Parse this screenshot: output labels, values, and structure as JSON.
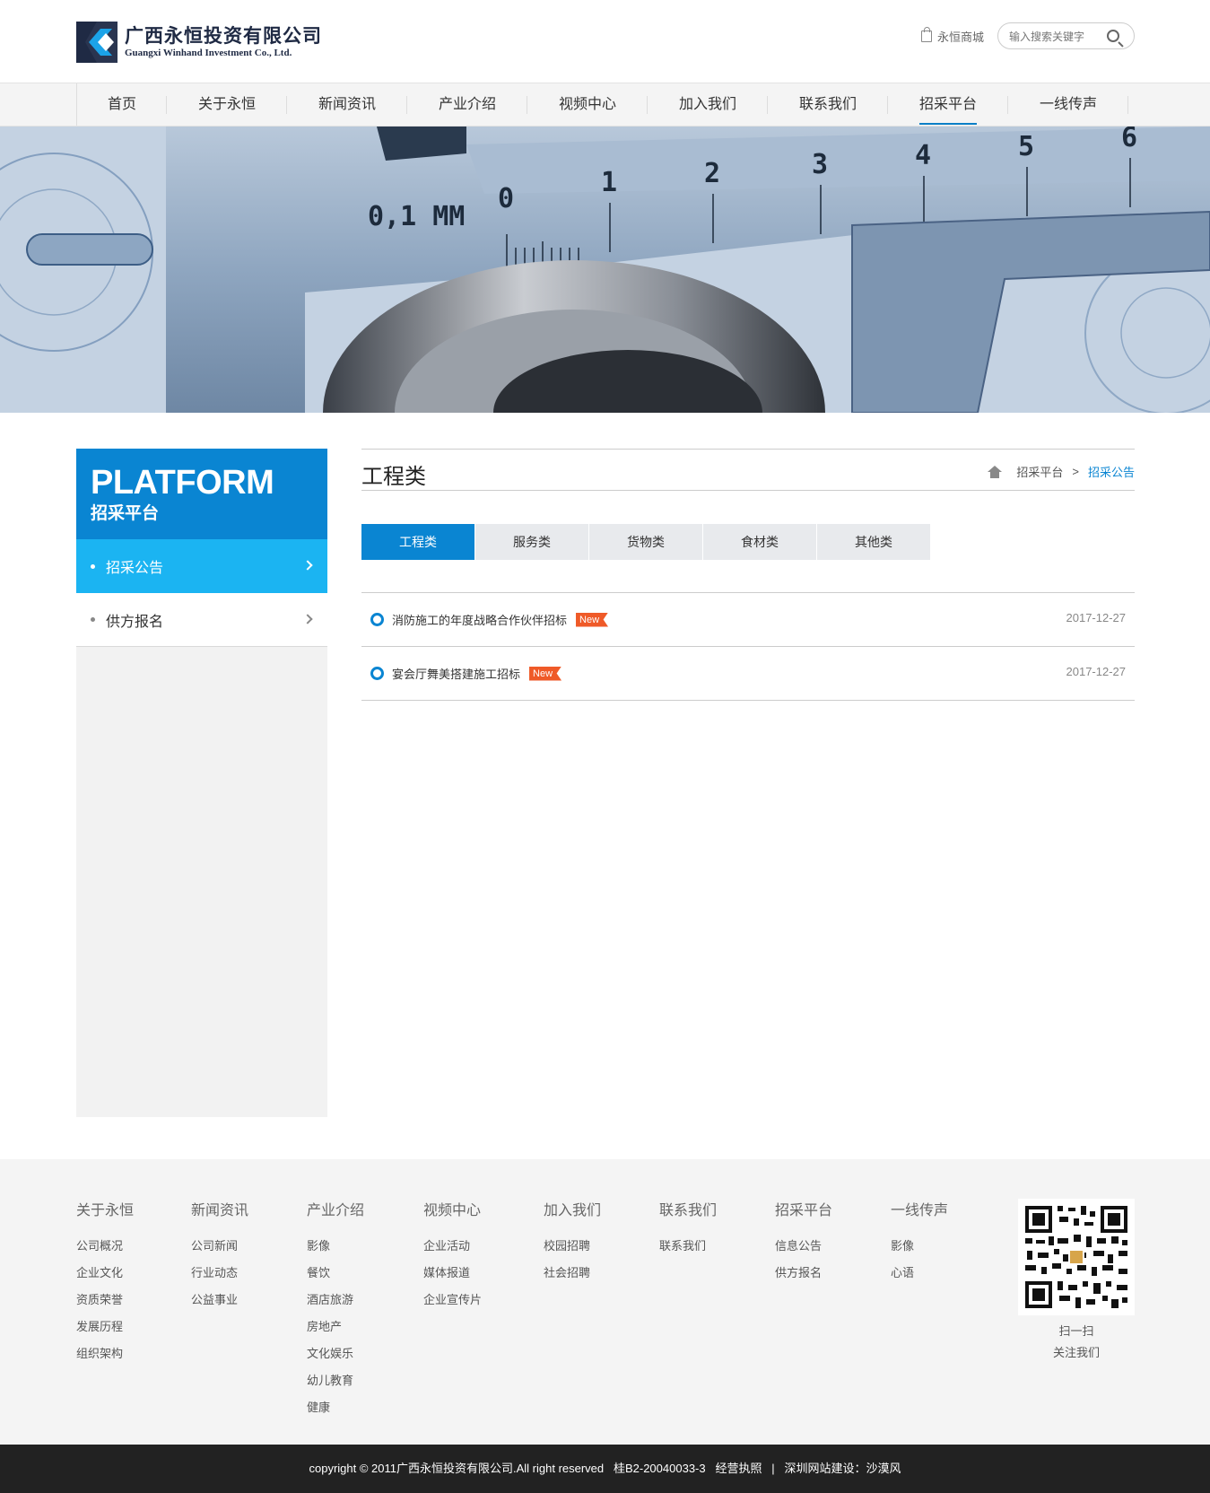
{
  "header": {
    "logo_cn": "广西永恒投资有限公司",
    "logo_en": "Guangxi Winhand Investment Co., Ltd.",
    "shop_label": "永恒商城",
    "search_placeholder": "输入搜索关键字"
  },
  "nav": {
    "items": [
      "首页",
      "关于永恒",
      "新闻资讯",
      "产业介绍",
      "视频中心",
      "加入我们",
      "联系我们",
      "招采平台",
      "一线传声"
    ],
    "active": "招采平台"
  },
  "sidebar": {
    "title_en": "PLATFORM",
    "title_cn": "招采平台",
    "items": [
      {
        "label": "招采公告",
        "active": true
      },
      {
        "label": "供方报名",
        "active": false
      }
    ]
  },
  "main": {
    "title": "工程类",
    "breadcrumb": {
      "parent": "招采平台",
      "separator": ">",
      "current": "招采公告"
    },
    "tabs": [
      "工程类",
      "服务类",
      "货物类",
      "食材类",
      "其他类"
    ],
    "news": [
      {
        "title": "消防施工的年度战略合作伙伴招标",
        "tag": "New",
        "date": "2017-12-27"
      },
      {
        "title": "宴会厅舞美搭建施工招标",
        "tag": "New",
        "date": "2017-12-27"
      }
    ]
  },
  "footer": {
    "columns": [
      {
        "heading": "关于永恒",
        "links": [
          "公司概况",
          "企业文化",
          "资质荣誉",
          "发展历程",
          "组织架构"
        ]
      },
      {
        "heading": "新闻资讯",
        "links": [
          "公司新闻",
          "行业动态",
          "公益事业"
        ]
      },
      {
        "heading": "产业介绍",
        "links": [
          "影像",
          "餐饮",
          "酒店旅游",
          "房地产",
          "文化娱乐",
          "幼儿教育",
          "健康"
        ]
      },
      {
        "heading": "视频中心",
        "links": [
          "企业活动",
          "媒体报道",
          "企业宣传片"
        ]
      },
      {
        "heading": "加入我们",
        "links": [
          "校园招聘",
          "社会招聘"
        ]
      },
      {
        "heading": "联系我们",
        "links": [
          "联系我们"
        ]
      },
      {
        "heading": "招采平台",
        "links": [
          "信息公告",
          "供方报名"
        ]
      },
      {
        "heading": "一线传声",
        "links": [
          "影像",
          "心语"
        ]
      }
    ],
    "qr_line1": "扫一扫",
    "qr_line2": "关注我们",
    "copyright": "copyright © 2011广西永恒投资有限公司.All right reserved   桂B2-20040033-3   经营执照   |   深圳网站建设：沙漠风"
  },
  "colors": {
    "primary": "#0a85d2",
    "sidebar_active": "#1bb4f2",
    "new_tag": "#ef5a28",
    "footer_bg": "#f4f4f4",
    "copyright_bg": "#222222"
  }
}
